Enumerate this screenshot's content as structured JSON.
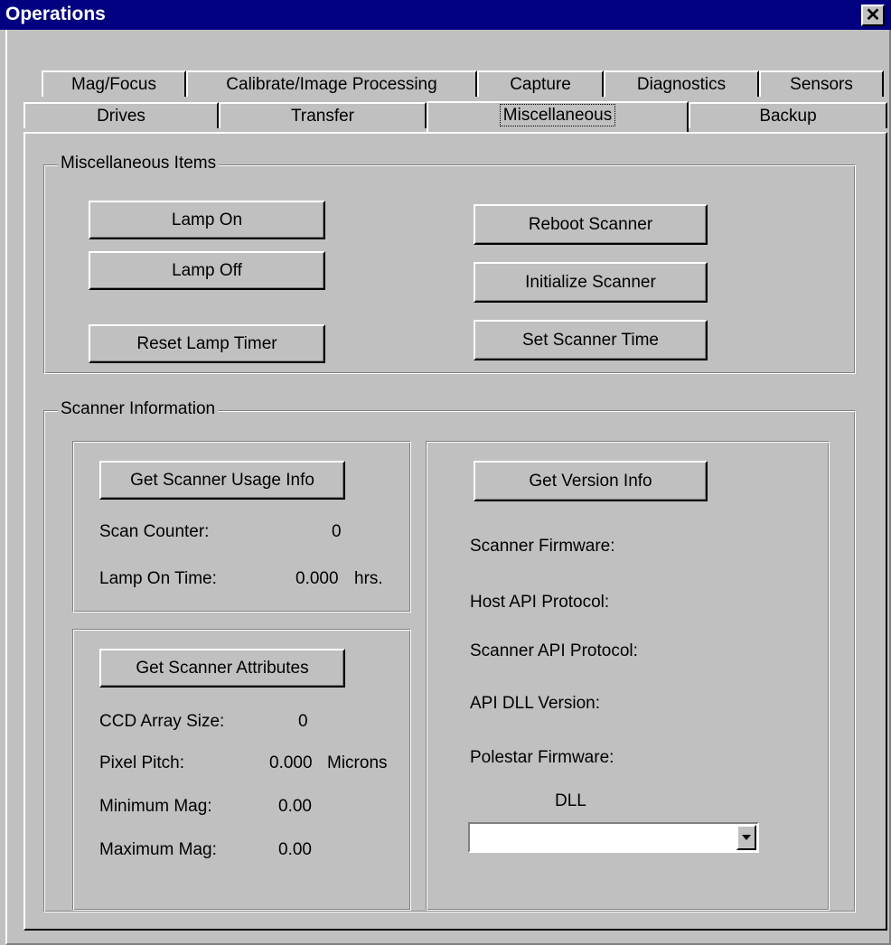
{
  "window": {
    "title": "Operations",
    "close_glyph": "✕"
  },
  "tabs": {
    "row_back": [
      "Mag/Focus",
      "Calibrate/Image Processing",
      "Capture",
      "Diagnostics",
      "Sensors"
    ],
    "row_front": [
      "Drives",
      "Transfer",
      "Miscellaneous",
      "Backup"
    ],
    "active": "Miscellaneous"
  },
  "misc_items": {
    "group_label": "Miscellaneous Items",
    "lamp_on": "Lamp On",
    "lamp_off": "Lamp Off",
    "reset_lamp_timer": "Reset Lamp Timer",
    "reboot_scanner": "Reboot Scanner",
    "initialize_scanner": "Initialize Scanner",
    "set_scanner_time": "Set Scanner Time"
  },
  "scanner_info": {
    "group_label": "Scanner Information",
    "usage": {
      "button": "Get Scanner Usage Info",
      "scan_counter_label": "Scan Counter:",
      "scan_counter_value": "0",
      "lamp_on_time_label": "Lamp On Time:",
      "lamp_on_time_value": "0.000",
      "lamp_on_time_unit": "hrs."
    },
    "attributes": {
      "button": "Get Scanner Attributes",
      "ccd_label": "CCD Array Size:",
      "ccd_value": "0",
      "pixel_pitch_label": "Pixel Pitch:",
      "pixel_pitch_value": "0.000",
      "pixel_pitch_unit": "Microns",
      "min_mag_label": "Minimum Mag:",
      "min_mag_value": "0.00",
      "max_mag_label": "Maximum Mag:",
      "max_mag_value": "0.00"
    },
    "version": {
      "button": "Get Version Info",
      "scanner_firmware_label": "Scanner Firmware:",
      "host_api_label": "Host API Protocol:",
      "scanner_api_label": "Scanner API Protocol:",
      "api_dll_label": "API DLL Version:",
      "polestar_label": "Polestar Firmware:",
      "dll_label": "DLL",
      "dll_selected": ""
    }
  },
  "icons": {
    "close": "close-icon",
    "dropdown": "chevron-down-icon"
  }
}
